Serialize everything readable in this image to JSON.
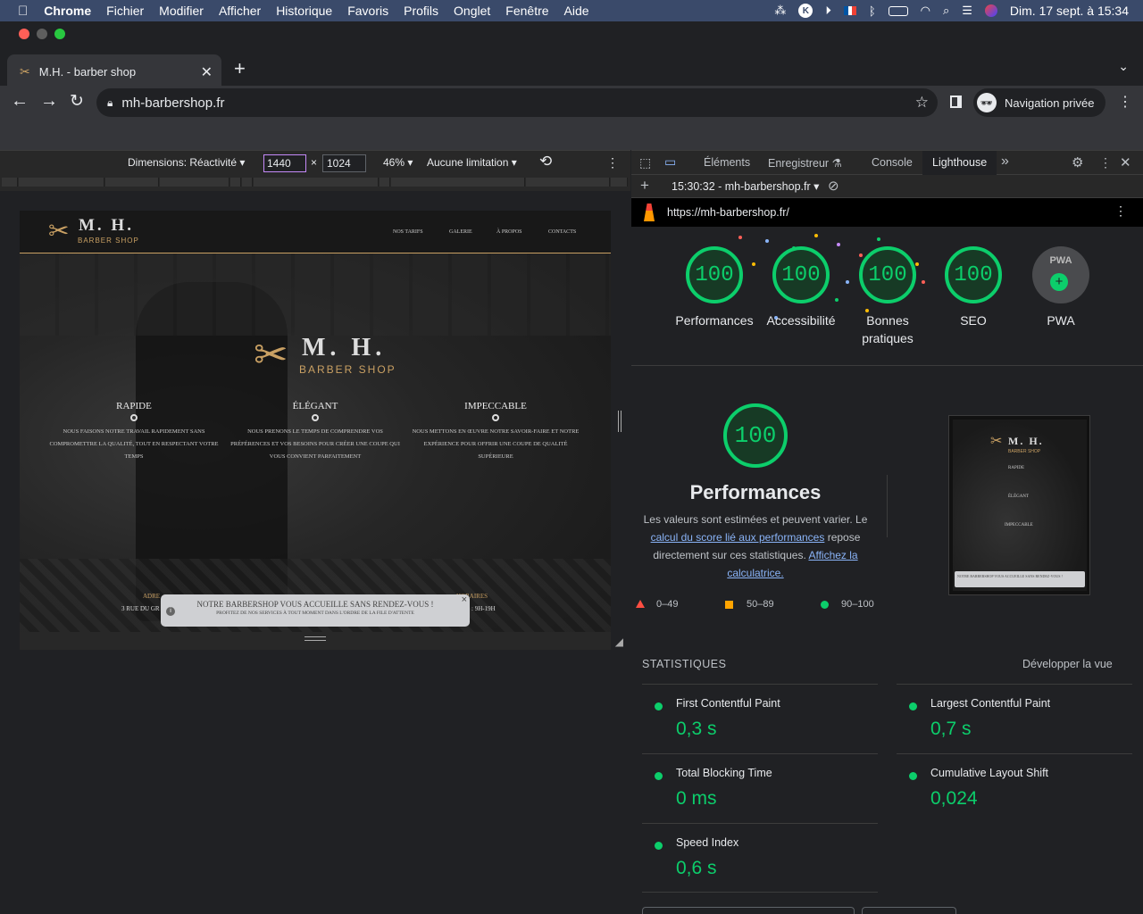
{
  "menubar": {
    "app": "Chrome",
    "items": [
      "Fichier",
      "Modifier",
      "Afficher",
      "Historique",
      "Favoris",
      "Profils",
      "Onglet",
      "Fenêtre",
      "Aide"
    ],
    "datetime": "Dim. 17 sept. à  15:34"
  },
  "browser": {
    "tab_title": "M.H. - barber shop",
    "url": "mh-barbershop.fr",
    "private_label": "Navigation privée"
  },
  "device_toolbar": {
    "dimensions": "Dimensions: Réactivité",
    "width": "1440",
    "times": "×",
    "height": "1024",
    "zoom": "46%",
    "throttle": "Aucune limitation"
  },
  "site": {
    "logo_main": "M. H.",
    "logo_sub": "BARBER SHOP",
    "nav": [
      "NOS TARIFS",
      "GALERIE",
      "À PROPOS",
      "CONTACTS"
    ],
    "hero_logo_main": "M. H.",
    "hero_logo_sub": "BARBER SHOP",
    "features": [
      {
        "title": "RAPIDE",
        "text": "NOUS FAISONS NOTRE TRAVAIL RAPIDEMENT SANS COMPROMETTRE LA QUALITÉ, TOUT EN RESPECTANT VOTRE TEMPS"
      },
      {
        "title": "ÉLÉGANT",
        "text": "NOUS PRENONS LE TEMPS DE COMPRENDRE VOS PRÉFÉRENCES ET VOS BESOINS POUR CRÉER UNE COUPE QUI VOUS CONVIENT PARFAITEMENT"
      },
      {
        "title": "IMPECCABLE",
        "text": "NOUS METTONS EN ŒUVRE NOTRE SAVOIR-FAIRE ET NOTRE EXPÉRIENCE POUR OFFRIR UNE COUPE DE QUALITÉ SUPÉRIEURE"
      }
    ],
    "footer_left_title": "ADRE",
    "footer_left_text": "3 RUE DU GR",
    "footer_right_title": "HORAIRES",
    "footer_right_text": ": 9H-19H",
    "toast_title": "NOTRE BARBERSHOP VOUS ACCUEILLE SANS RENDEZ-VOUS !",
    "toast_text": "PROFITEZ DE NOS SERVICES À TOUT MOMENT DANS L'ORDRE DE LA FILE D'ATTENTE",
    "toast_close": "×"
  },
  "devtools": {
    "tabs": [
      "Éléments",
      "Enregistreur",
      "Console",
      "Lighthouse"
    ],
    "active_tab": "Lighthouse",
    "report_time": "15:30:32 - mh-barbershop.fr",
    "report_url": "https://mh-barbershop.fr/",
    "scores": [
      {
        "label": "Performances",
        "value": "100"
      },
      {
        "label": "Accessibilité",
        "value": "100"
      },
      {
        "label": "Bonnes pratiques",
        "value": "100"
      },
      {
        "label": "SEO",
        "value": "100"
      },
      {
        "label": "PWA",
        "value": "PWA"
      }
    ],
    "perf_score": "100",
    "perf_title": "Performances",
    "perf_desc_1": "Les valeurs sont estimées et peuvent varier. Le",
    "perf_link_1": "calcul du score lié aux performances",
    "perf_desc_2": "repose directement sur ces statistiques.",
    "perf_link_2": "Affichez la calculatrice.",
    "legend": [
      "0–49",
      "50–89",
      "90–100"
    ],
    "stats_title": "STATISTIQUES",
    "expand": "Développer la vue",
    "metrics": [
      {
        "name": "First Contentful Paint",
        "value": "0,3 s"
      },
      {
        "name": "Largest Contentful Paint",
        "value": "0,7 s"
      },
      {
        "name": "Total Blocking Time",
        "value": "0 ms"
      },
      {
        "name": "Cumulative Layout Shift",
        "value": "0,024"
      },
      {
        "name": "Speed Index",
        "value": "0,6 s"
      }
    ],
    "thumb_logo": "M. H.",
    "thumb_sub": "BARBER SHOP",
    "thumb_f1": "RAPIDE",
    "thumb_f2": "ÉLÉGANT",
    "thumb_f3": "IMPECCABLE",
    "thumb_toast": "NOTRE BARBERSHOP VOUS ACCUEILLE SANS RENDEZ-VOUS !"
  },
  "colors": {
    "green": "#0cce6b",
    "gold": "#c9a063",
    "accent_blue": "#8ab4f8"
  }
}
